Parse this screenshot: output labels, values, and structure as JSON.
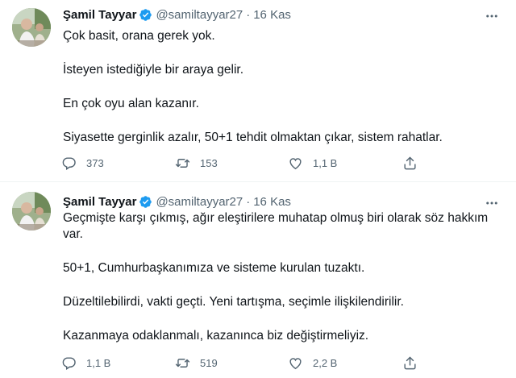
{
  "tweets": [
    {
      "author": {
        "name": "Şamil Tayyar",
        "handle": "@samiltayyar27",
        "verified": true
      },
      "date": "16 Kas",
      "paragraphs": [
        "Çok basit, orana gerek yok.",
        "İsteyen istediğiyle bir araya gelir.",
        "En çok oyu alan kazanır.",
        "Siyasette gerginlik azalır, 50+1 tehdit olmaktan çıkar, sistem rahatlar."
      ],
      "stats": {
        "replies": "373",
        "retweets": "153",
        "likes": "1,1 B"
      }
    },
    {
      "author": {
        "name": "Şamil Tayyar",
        "handle": "@samiltayyar27",
        "verified": true
      },
      "date": "16 Kas",
      "paragraphs": [
        "Geçmişte karşı çıkmış, ağır eleştirilere muhatap olmuş biri olarak söz hakkım var.",
        "50+1, Cumhurbaşkanımıza ve sisteme kurulan tuzaktı.",
        "Düzeltilebilirdi, vakti geçti. Yeni tartışma, seçimle ilişkilendirilir.",
        "Kazanmaya odaklanmalı, kazanınca biz değiştirmeliyiz."
      ],
      "stats": {
        "replies": "1,1 B",
        "retweets": "519",
        "likes": "2,2 B"
      }
    }
  ],
  "icons": {
    "verified": "verified-badge-icon",
    "more": "more-options-icon",
    "reply": "reply-icon",
    "retweet": "retweet-icon",
    "like": "heart-icon",
    "share": "share-icon"
  },
  "colors": {
    "text": "#0f1419",
    "secondary": "#536471",
    "verified": "#1d9bf0",
    "divider": "#eff3f4"
  }
}
